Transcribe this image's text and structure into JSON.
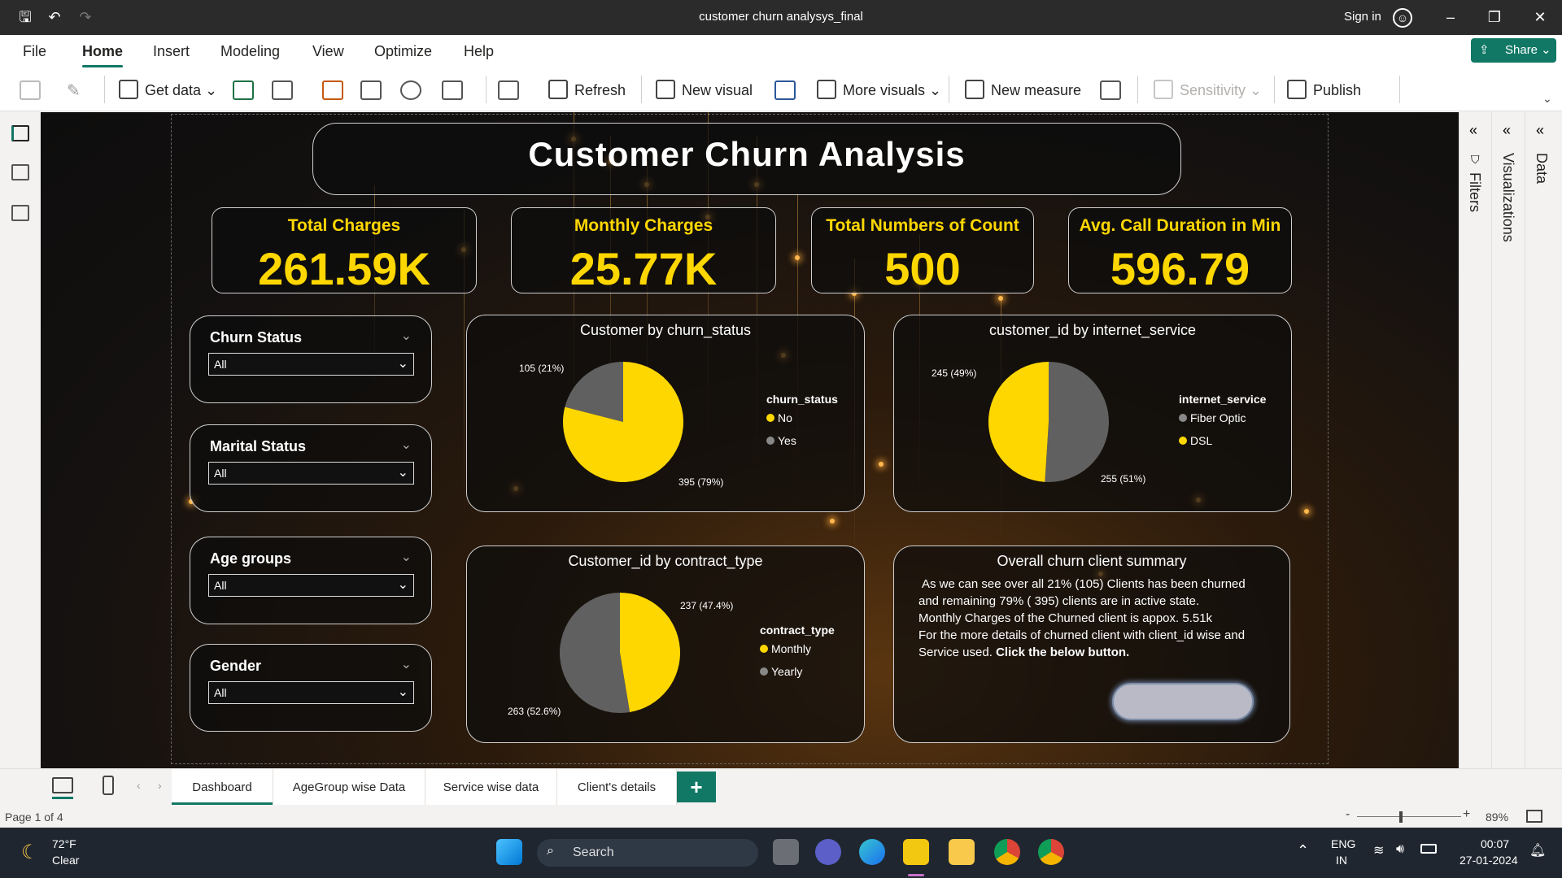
{
  "window": {
    "title": "customer churn analysys_final",
    "sign_in": "Sign in"
  },
  "menu": {
    "items": [
      "File",
      "Home",
      "Insert",
      "Modeling",
      "View",
      "Optimize",
      "Help"
    ],
    "share": "Share"
  },
  "ribbon": {
    "get_data": "Get data",
    "refresh": "Refresh",
    "new_visual": "New visual",
    "more_visuals": "More visuals",
    "new_measure": "New measure",
    "sensitivity": "Sensitivity",
    "publish": "Publish"
  },
  "report": {
    "title": "Customer Churn Analysis",
    "kpis": [
      {
        "title": "Total Charges",
        "value": "261.59K"
      },
      {
        "title": "Monthly Charges",
        "value": "25.77K"
      },
      {
        "title": "Total Numbers of Count",
        "value": "500"
      },
      {
        "title": "Avg. Call Duration in Min",
        "value": "596.79"
      }
    ],
    "slicers": [
      {
        "title": "Churn Status",
        "value": "All"
      },
      {
        "title": "Marital Status",
        "value": "All"
      },
      {
        "title": "Age groups",
        "value": "All"
      },
      {
        "title": "Gender",
        "value": "All"
      }
    ],
    "summary": {
      "title": "Overall churn client summary",
      "lines": [
        "As we can  see over all 21% (105) Clients has been churned",
        "and remaining 79% ( 395) clients are in active state.",
        "Monthly Charges of the Churned client is appox. 5.51k",
        "For the more details of churned client with client_id wise and",
        "Service used."
      ],
      "bold_tail": "Click the below button."
    }
  },
  "chart_data": [
    {
      "type": "pie",
      "title": "Customer by churn_status",
      "legend_title": "churn_status",
      "categories": [
        "No",
        "Yes"
      ],
      "values": [
        395,
        105
      ],
      "labels": [
        "395 (79%)",
        "105 (21%)"
      ],
      "colors": [
        "#ffd700",
        "#606060"
      ]
    },
    {
      "type": "pie",
      "title": "customer_id by internet_service",
      "legend_title": "internet_service",
      "categories": [
        "Fiber Optic",
        "DSL"
      ],
      "values": [
        255,
        245
      ],
      "labels": [
        "255 (51%)",
        "245 (49%)"
      ],
      "colors": [
        "#606060",
        "#ffd700"
      ]
    },
    {
      "type": "pie",
      "title": "Customer_id by contract_type",
      "legend_title": "contract_type",
      "categories": [
        "Monthly",
        "Yearly"
      ],
      "values": [
        237,
        263
      ],
      "labels": [
        "237 (47.4%)",
        "263 (52.6%)"
      ],
      "colors": [
        "#ffd700",
        "#606060"
      ]
    }
  ],
  "panes": {
    "filters": "Filters",
    "visualizations": "Visualizations",
    "data": "Data"
  },
  "tabs": [
    "Dashboard",
    "AgeGroup wise Data",
    "Service wise data",
    "Client's details"
  ],
  "status": {
    "page": "Page 1 of 4",
    "zoom": "89%"
  },
  "taskbar": {
    "temp": "72°F",
    "weather": "Clear",
    "search": "Search",
    "lang1": "ENG",
    "lang2": "IN",
    "time": "00:07",
    "date": "27-01-2024"
  }
}
